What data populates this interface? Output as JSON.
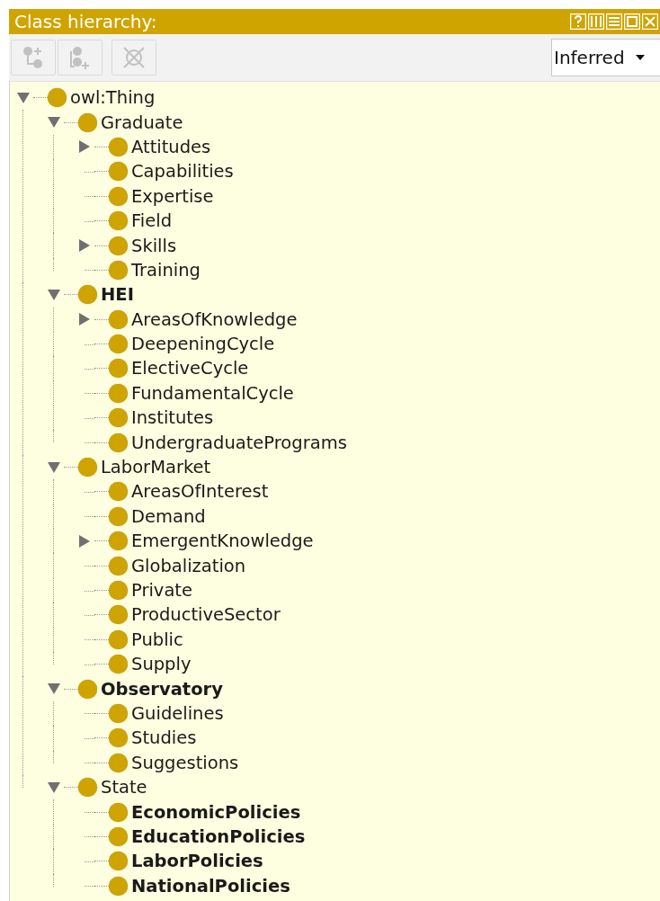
{
  "panel": {
    "title": "Class hierarchy:"
  },
  "toolbar": {
    "buttons": [
      {
        "kind": "add-subclass",
        "disabled": true
      },
      {
        "kind": "add-sibling",
        "disabled": true
      },
      {
        "kind": "delete",
        "disabled": true
      }
    ],
    "view_select": {
      "value": "Inferred"
    }
  },
  "tree": [
    {
      "label": "owl:Thing",
      "bold": false,
      "expanded": true,
      "children": [
        {
          "label": "Graduate",
          "bold": false,
          "expanded": true,
          "children": [
            {
              "label": "Attitudes",
              "bold": false,
              "expanded": false
            },
            {
              "label": "Capabilities",
              "bold": false
            },
            {
              "label": "Expertise",
              "bold": false
            },
            {
              "label": "Field",
              "bold": false
            },
            {
              "label": "Skills",
              "bold": false,
              "expanded": false
            },
            {
              "label": "Training",
              "bold": false
            }
          ]
        },
        {
          "label": "HEI",
          "bold": true,
          "expanded": true,
          "children": [
            {
              "label": "AreasOfKnowledge",
              "bold": false,
              "expanded": false
            },
            {
              "label": "DeepeningCycle",
              "bold": false
            },
            {
              "label": "ElectiveCycle",
              "bold": false
            },
            {
              "label": "FundamentalCycle",
              "bold": false
            },
            {
              "label": "Institutes",
              "bold": false
            },
            {
              "label": "UndergraduatePrograms",
              "bold": false
            }
          ]
        },
        {
          "label": "LaborMarket",
          "bold": false,
          "expanded": true,
          "children": [
            {
              "label": "AreasOfInterest",
              "bold": false
            },
            {
              "label": "Demand",
              "bold": false
            },
            {
              "label": "EmergentKnowledge",
              "bold": false,
              "expanded": false
            },
            {
              "label": "Globalization",
              "bold": false
            },
            {
              "label": "Private",
              "bold": false
            },
            {
              "label": "ProductiveSector",
              "bold": false
            },
            {
              "label": "Public",
              "bold": false
            },
            {
              "label": "Supply",
              "bold": false
            }
          ]
        },
        {
          "label": "Observatory",
          "bold": true,
          "expanded": true,
          "children": [
            {
              "label": "Guidelines",
              "bold": false
            },
            {
              "label": "Studies",
              "bold": false
            },
            {
              "label": "Suggestions",
              "bold": false
            }
          ]
        },
        {
          "label": "State",
          "bold": false,
          "expanded": true,
          "children": [
            {
              "label": "EconomicPolicies",
              "bold": true
            },
            {
              "label": "EducationPolicies",
              "bold": true
            },
            {
              "label": "LaborPolicies",
              "bold": true
            },
            {
              "label": "NationalPolicies",
              "bold": true
            }
          ]
        }
      ]
    }
  ]
}
